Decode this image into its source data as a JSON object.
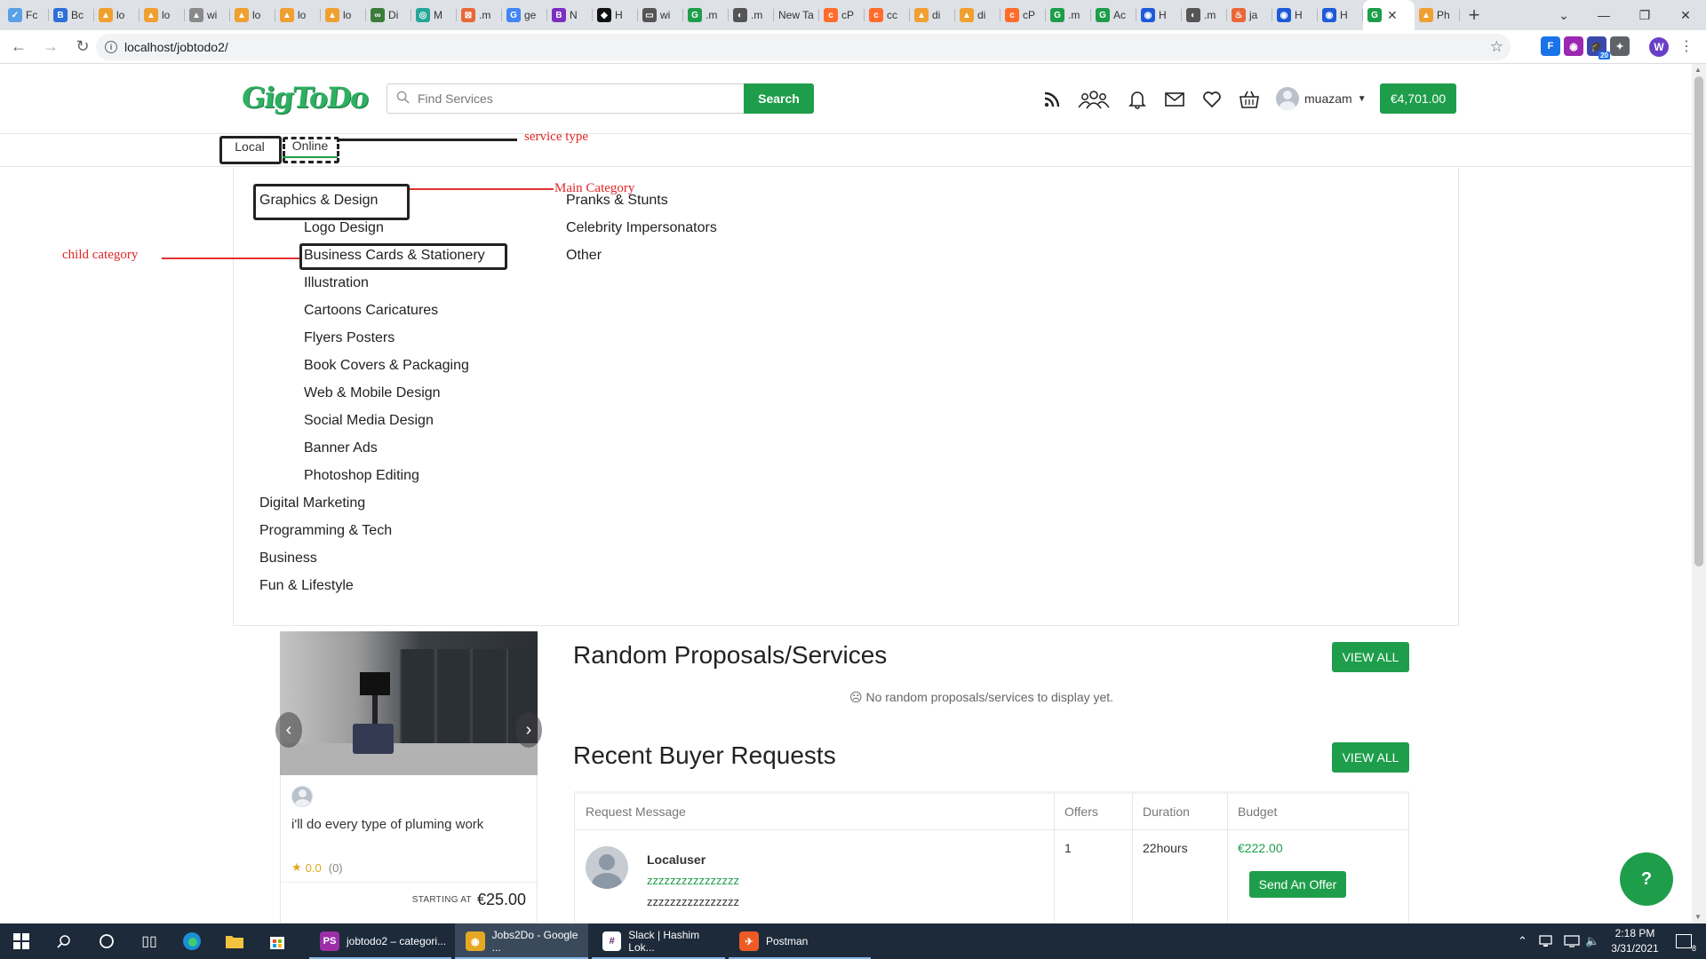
{
  "browser": {
    "tabs": [
      {
        "label": "Fc",
        "color": "#5aa0e6",
        "glyph": "✓"
      },
      {
        "label": "Bc",
        "color": "#2f6fd8",
        "glyph": "B"
      },
      {
        "label": "lo",
        "color": "#f0a030",
        "glyph": "▲"
      },
      {
        "label": "lo",
        "color": "#f0a030",
        "glyph": "▲"
      },
      {
        "label": "wi",
        "color": "#8a8a8a",
        "glyph": "▲"
      },
      {
        "label": "lo",
        "color": "#f0a030",
        "glyph": "▲"
      },
      {
        "label": "lo",
        "color": "#f0a030",
        "glyph": "▲"
      },
      {
        "label": "lo",
        "color": "#f0a030",
        "glyph": "▲"
      },
      {
        "label": "Di",
        "color": "#3a7d3a",
        "glyph": "∞"
      },
      {
        "label": "M",
        "color": "#26a69a",
        "glyph": "◎"
      },
      {
        "label": ".m",
        "color": "#e8683a",
        "glyph": "⊠"
      },
      {
        "label": "ge",
        "color": "#4285f4",
        "glyph": "G"
      },
      {
        "label": "N",
        "color": "#7b2fbf",
        "glyph": "B"
      },
      {
        "label": "H",
        "color": "#111111",
        "glyph": "◆"
      },
      {
        "label": "wi",
        "color": "#555555",
        "glyph": "▭"
      },
      {
        "label": ".m",
        "color": "#1e9e4b",
        "glyph": "G"
      },
      {
        "label": ".m",
        "color": "#555555",
        "glyph": "◐"
      },
      {
        "label": "New Ta",
        "color": "#dee1e6",
        "glyph": ""
      },
      {
        "label": "cP",
        "color": "#ff6c2c",
        "glyph": "c"
      },
      {
        "label": "cc",
        "color": "#ff6c2c",
        "glyph": "c"
      },
      {
        "label": "di",
        "color": "#f0a030",
        "glyph": "▲"
      },
      {
        "label": "di",
        "color": "#f0a030",
        "glyph": "▲"
      },
      {
        "label": "cP",
        "color": "#ff6c2c",
        "glyph": "c"
      },
      {
        "label": ".m",
        "color": "#1e9e4b",
        "glyph": "G"
      },
      {
        "label": "Ac",
        "color": "#1e9e4b",
        "glyph": "G"
      },
      {
        "label": "H",
        "color": "#1e5bd8",
        "glyph": "◉"
      },
      {
        "label": ".m",
        "color": "#555555",
        "glyph": "◐"
      },
      {
        "label": "ja",
        "color": "#e8683a",
        "glyph": "♨"
      },
      {
        "label": "H",
        "color": "#1e5bd8",
        "glyph": "◉"
      },
      {
        "label": "H",
        "color": "#1e5bd8",
        "glyph": "◉"
      }
    ],
    "active_tab": {
      "label": "",
      "color": "#1e9e4b",
      "glyph": "G"
    },
    "last_tab": {
      "label": "Ph",
      "color": "#f0a030",
      "glyph": "▲"
    },
    "new_tab_label": "+",
    "url": "localhost/jobtodo2/",
    "extensions": [
      {
        "name": "fi-extension",
        "color": "#1a73e8",
        "glyph": "F"
      },
      {
        "name": "color-extension",
        "color": "#9c27b0",
        "glyph": "◉"
      },
      {
        "name": "cap-extension",
        "color": "#3949ab",
        "glyph": "🎓",
        "badge": "20"
      },
      {
        "name": "puzzle-extension",
        "color": "#5f6368",
        "glyph": "✦"
      }
    ],
    "profile_letter": "W",
    "profile_color": "#6a3fc8"
  },
  "header": {
    "logo": "GigToDo",
    "search_placeholder": "Find Services",
    "search_button": "Search",
    "username": "muazam",
    "balance": "€4,701.00"
  },
  "service_type": {
    "options": [
      "Local",
      "Online"
    ],
    "selected": "Online"
  },
  "annotations": {
    "service_type": "service type",
    "main_category": "Main Category",
    "child_category": "child category"
  },
  "menu": {
    "main_open": "Graphics & Design",
    "children": [
      "Logo Design",
      "Business Cards & Stationery",
      "Illustration",
      "Cartoons Caricatures",
      "Flyers Posters",
      "Book Covers & Packaging",
      "Web & Mobile Design",
      "Social Media Design",
      "Banner Ads",
      "Photoshop Editing"
    ],
    "other_mains": [
      "Digital Marketing",
      "Programming & Tech",
      "Business",
      "Fun & Lifestyle"
    ],
    "column2": [
      "Pranks & Stunts",
      "Celebrity Impersonators",
      "Other"
    ]
  },
  "featured": {
    "title": "i'll do every type of pluming work",
    "rating": "0.0",
    "rating_count": "(0)",
    "starting_label": "STARTING AT",
    "price": "€25.00"
  },
  "random": {
    "heading": "Random Proposals/Services",
    "view_all": "VIEW ALL",
    "empty": "No random proposals/services to display yet."
  },
  "requests": {
    "heading": "Recent Buyer Requests",
    "view_all": "VIEW ALL",
    "columns": [
      "Request Message",
      "Offers",
      "Duration",
      "Budget"
    ],
    "rows": [
      {
        "user": "Localuser",
        "link": "zzzzzzzzzzzzzzzz",
        "message": "zzzzzzzzzzzzzzzz",
        "offers": "1",
        "duration": "22hours",
        "budget": "€222.00",
        "action": "Send An Offer"
      }
    ]
  },
  "taskbar": {
    "apps": [
      {
        "label": "jobtodo2 – categori...",
        "color": "#9b2fa8",
        "glyph": "PS"
      },
      {
        "label": "Jobs2Do - Google ...",
        "color": "#e5a823",
        "glyph": "◉"
      },
      {
        "label": "Slack | Hashim Lok...",
        "color": "#ffffff",
        "glyph": "#"
      },
      {
        "label": "Postman",
        "color": "#ef5b25",
        "glyph": "✈"
      }
    ],
    "time": "2:18 PM",
    "date": "3/31/2021",
    "notification_count": "8"
  },
  "colors": {
    "brand_green": "#1e9e4b",
    "annotation_red": "#e12626"
  }
}
